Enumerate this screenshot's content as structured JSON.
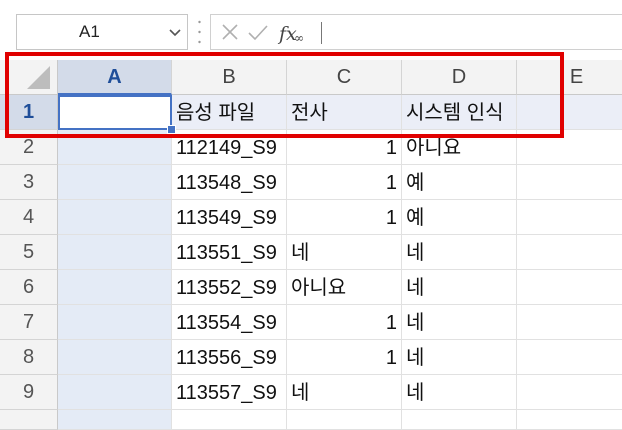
{
  "name_box": {
    "value": "A1"
  },
  "formula_bar": {
    "fx_label": "fx",
    "value": ""
  },
  "columns": [
    "A",
    "B",
    "C",
    "D",
    "E"
  ],
  "selected_column": "A",
  "rows": [
    {
      "num": "1",
      "A": "",
      "B": "음성 파일",
      "C": "전사",
      "D": "시스템 인식"
    },
    {
      "num": "2",
      "A": "",
      "B": "112149_S9",
      "C": "1",
      "D": "아니요"
    },
    {
      "num": "3",
      "A": "",
      "B": "113548_S9",
      "C": "1",
      "D": "예"
    },
    {
      "num": "4",
      "A": "",
      "B": "113549_S9",
      "C": "1",
      "D": "예"
    },
    {
      "num": "5",
      "A": "",
      "B": "113551_S9",
      "C": "네",
      "D": "네"
    },
    {
      "num": "6",
      "A": "",
      "B": "113552_S9",
      "C": "아니요",
      "D": "네"
    },
    {
      "num": "7",
      "A": "",
      "B": "113554_S9",
      "C": "1",
      "D": "네"
    },
    {
      "num": "8",
      "A": "",
      "B": "113556_S9",
      "C": "1",
      "D": "네"
    },
    {
      "num": "9",
      "A": "",
      "B": "113557_S9",
      "C": "네",
      "D": "네"
    }
  ],
  "colors": {
    "highlight_box": "#e00000",
    "selection": "#4472c4"
  }
}
